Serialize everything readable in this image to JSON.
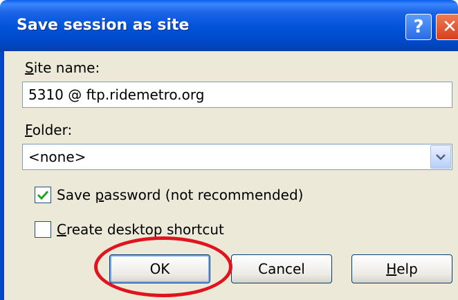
{
  "dialog": {
    "title": "Save session as site",
    "help_glyph": "?",
    "close_glyph": "✕"
  },
  "site_name": {
    "label_first": "S",
    "label_rest": "ite name:",
    "value": "5310 @ ftp.ridemetro.org"
  },
  "folder": {
    "label_first": "F",
    "label_rest": "older:",
    "selected": "<none>"
  },
  "save_password": {
    "checked": true,
    "label_pre": "Save ",
    "label_u": "p",
    "label_post": "assword (not recommended)"
  },
  "desktop_shortcut": {
    "checked": false,
    "label_first": "C",
    "label_rest": "reate desktop shortcut"
  },
  "buttons": {
    "ok": "OK",
    "cancel": "Cancel",
    "help_first": "H",
    "help_rest": "elp"
  },
  "colors": {
    "titlebar": "#0052d8",
    "client": "#ece9d8",
    "annotation_oval": "#e0141e",
    "check": "#21a121"
  }
}
